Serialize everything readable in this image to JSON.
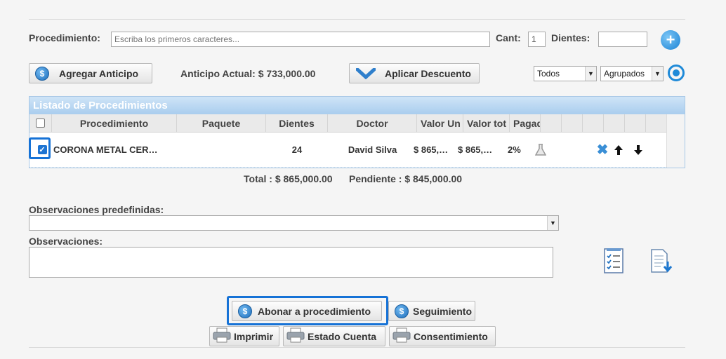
{
  "form": {
    "procedimiento_label": "Procedimiento:",
    "procedimiento_placeholder": "Escriba los primeros caracteres...",
    "cant_label": "Cant:",
    "cant_value": "1",
    "dientes_label": "Dientes:",
    "dientes_value": ""
  },
  "actions": {
    "agregar_anticipo": "Agregar Anticipo",
    "anticipo_actual": "Anticipo Actual: $ 733,000.00",
    "aplicar_descuento": "Aplicar Descuento",
    "filter_selected": "Todos",
    "group_selected": "Agrupados"
  },
  "grid": {
    "title": "Listado de Procedimientos",
    "columns": [
      "Procedimiento",
      "Paquete",
      "Dientes",
      "Doctor",
      "Valor Un",
      "Valor tot",
      "Pagad"
    ],
    "rows": [
      {
        "checked": true,
        "procedimiento": "CORONA METAL CER…",
        "paquete": "",
        "dientes": "24",
        "doctor": "David Silva",
        "valor_unit": "$ 865,…",
        "valor_total": "$ 865,…",
        "pagado": "2%"
      }
    ]
  },
  "totals": {
    "total": "Total : $ 865,000.00",
    "pendiente": "Pendiente : $ 845,000.00"
  },
  "observaciones": {
    "predefinidas_label": "Observaciones predefinidas:",
    "predefinidas_value": "",
    "label": "Observaciones:",
    "value": ""
  },
  "buttons": {
    "abonar": "Abonar a procedimiento",
    "seguimiento": "Seguimiento",
    "imprimir": "Imprimir",
    "estado_cuenta": "Estado Cuenta",
    "consentimiento": "Consentimiento"
  },
  "icons": {
    "add": "plus-circle-icon",
    "refresh": "user-refresh-icon",
    "dollar": "dollar-coin-icon",
    "discount": "chevron-down-icon",
    "lab": "flask-icon",
    "delete": "x-icon",
    "up": "arrow-up-icon",
    "down": "arrow-down-icon",
    "checklist": "checklist-document-icon",
    "download": "document-download-icon",
    "printer": "printer-icon"
  },
  "colors": {
    "accent": "#1672d6",
    "grid_header": "#a9cdee"
  }
}
